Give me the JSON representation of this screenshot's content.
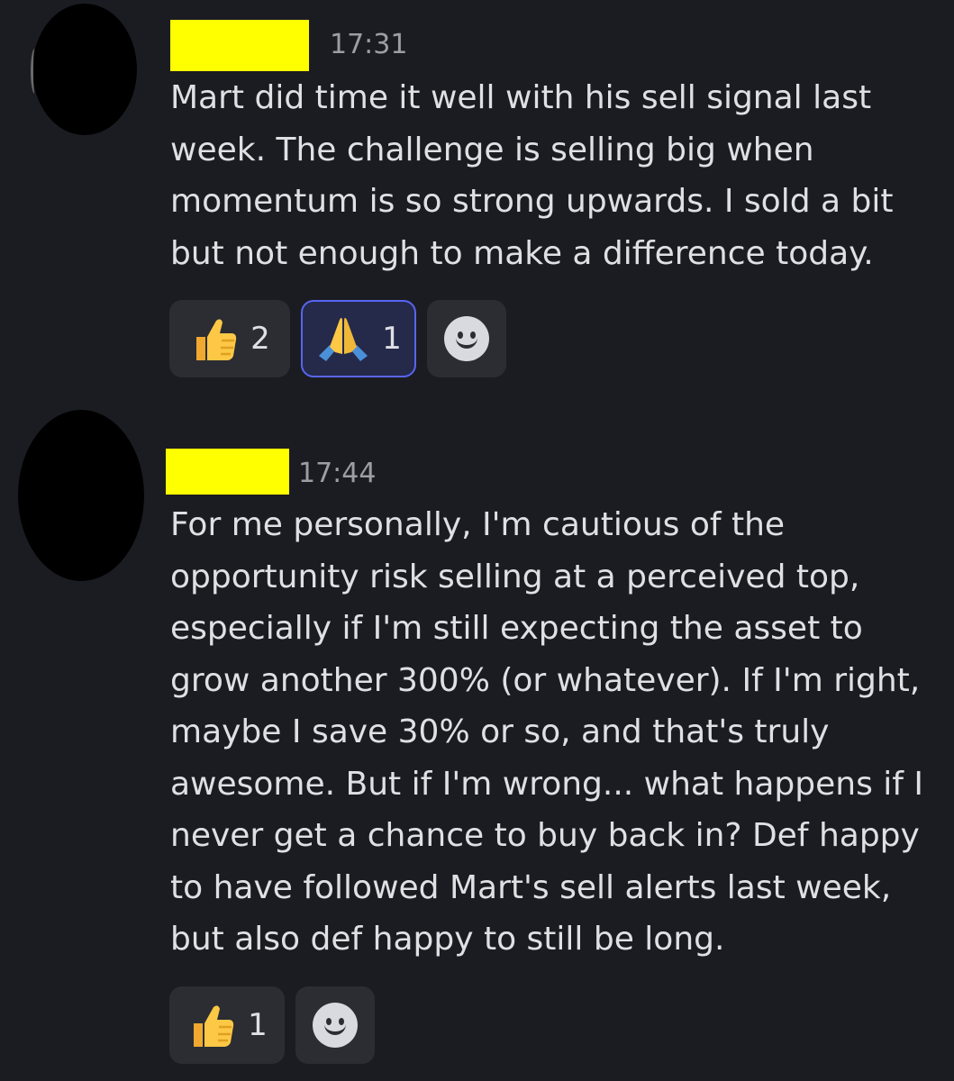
{
  "messages": [
    {
      "time": "17:31",
      "text": "Mart did time it well with his sell signal last\nweek. The challenge is selling big when\nmomentum is so strong upwards. I sold a bit\nbut not enough to make a difference today.",
      "reactions": [
        {
          "emoji": "thumbs-up-icon",
          "count": "2",
          "active": false
        },
        {
          "emoji": "folded-hands-icon",
          "count": "1",
          "active": true
        }
      ],
      "add_reaction_icon": "add-reaction-smiley-icon"
    },
    {
      "time": "17:44",
      "text": "For me personally, I'm cautious of the\nopportunity risk selling at a perceived top,\nespecially if I'm still expecting the asset to\ngrow another 300% (or whatever). If I'm right,\nmaybe I save 30% or so, and that's truly\nawesome. But if I'm wrong... what happens if I\nnever get a chance to buy back in? Def happy\nto have followed Mart's sell alerts last week,\nbut also def happy to still be long.",
      "reactions": [
        {
          "emoji": "thumbs-up-icon",
          "count": "1",
          "active": false
        }
      ],
      "add_reaction_icon": "add-reaction-smiley-icon"
    }
  ],
  "colors": {
    "background": "#1b1c21",
    "redaction": "#ffff00",
    "reaction_bg": "#2b2d33",
    "reaction_active_border": "#5865f2"
  }
}
